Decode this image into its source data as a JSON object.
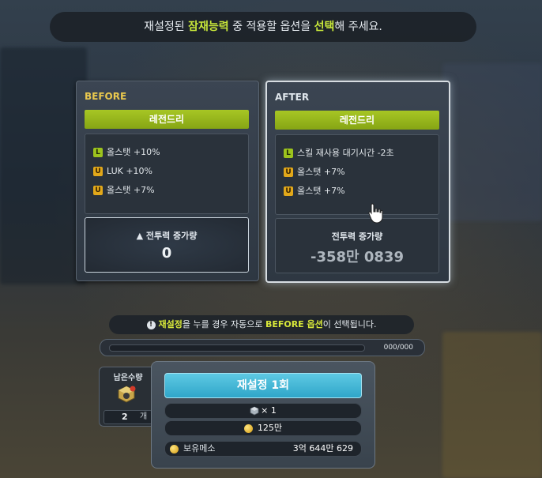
{
  "banner": {
    "part1": "재설정된 ",
    "highlight1": "잠재능력",
    "part2": " 중 적용할 옵션을 ",
    "highlight2": "선택",
    "part3": "해 주세요."
  },
  "before": {
    "title": "BEFORE",
    "grade": "레전드리",
    "options": [
      {
        "badge": "L",
        "text": "올스탯 +10%"
      },
      {
        "badge": "U",
        "text": "LUK +10%"
      },
      {
        "badge": "U",
        "text": "올스탯 +7%"
      }
    ],
    "power_label": "▲ 전투력 증가량",
    "power_value": "0"
  },
  "after": {
    "title": "AFTER",
    "grade": "레전드리",
    "options": [
      {
        "badge": "L",
        "text": "스킬 재사용 대기시간 -2초"
      },
      {
        "badge": "U",
        "text": "올스탯 +7%"
      },
      {
        "badge": "U",
        "text": "올스탯 +7%"
      }
    ],
    "power_label": "전투력 증가량",
    "power_value": "-358만 0839"
  },
  "notice": {
    "highlight1": "재설정",
    "part1": "을 누를 경우 자동으로 ",
    "highlight2": "BEFORE 옵션",
    "part2": "이 선택됩니다."
  },
  "progress": {
    "text": "000/000",
    "fraction": 0
  },
  "remaining": {
    "title": "남은수량",
    "count": "2",
    "unit": "개"
  },
  "reset": {
    "button_label": "재설정 1회",
    "cube_cost": "× 1",
    "meso_cost": "125만",
    "held_label": "보유메소",
    "held_value": "3억 644만 629"
  },
  "colors": {
    "accent_green": "#9cc31d",
    "accent_gold": "#e9c84e",
    "button_blue": "#2fa6c9"
  }
}
